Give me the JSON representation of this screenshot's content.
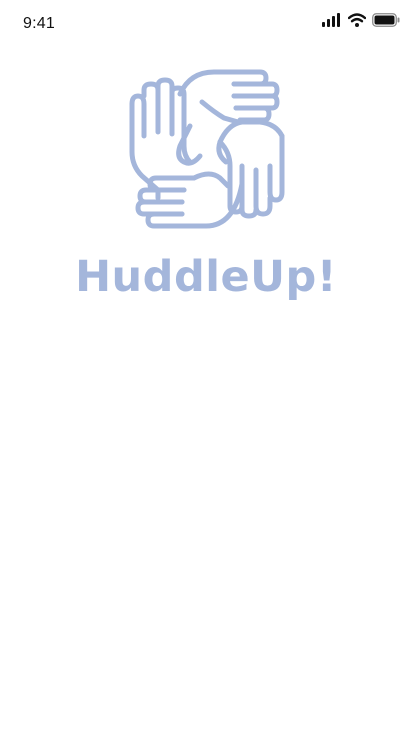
{
  "status_bar": {
    "time": "9:41",
    "icons": [
      "signal-icon",
      "wifi-icon",
      "battery-icon"
    ]
  },
  "splash": {
    "logo_icon": "hands-huddle-icon",
    "title": "HuddleUp!"
  },
  "colors": {
    "brand": "#A4B6DB",
    "status_text": "#111111",
    "background": "#FFFFFF"
  }
}
